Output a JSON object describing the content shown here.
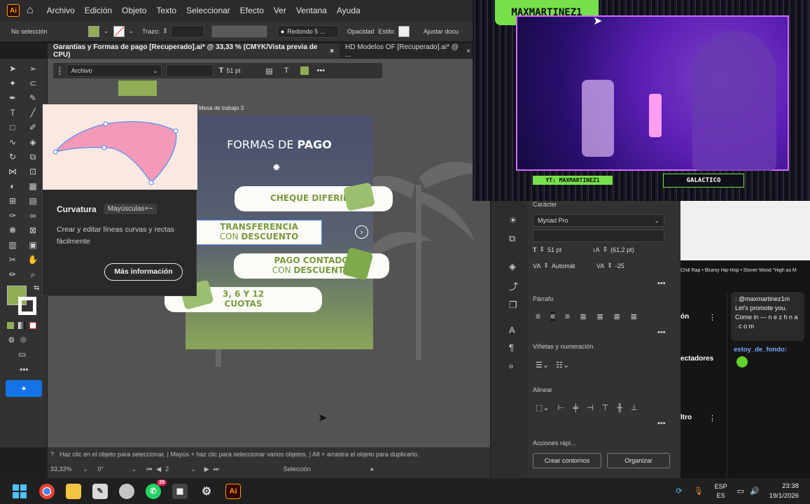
{
  "menu": [
    "Archivo",
    "Edición",
    "Objeto",
    "Texto",
    "Seleccionar",
    "Efecto",
    "Ver",
    "Ventana",
    "Ayuda"
  ],
  "app_logo": "Ai",
  "control": {
    "selection": "No selección",
    "stroke_label": "Trazo:",
    "brush": "Redondo 5 ...",
    "opacity": "Opacidad",
    "style": "Estilo:",
    "adjust": "Ajustar docu",
    "fill_color": "#8fae55"
  },
  "tabs": [
    "Garantías y Formas de pago [Recuperado].ai* @ 33,33 % (CMYK/Vista previa de CPU)",
    "HD Modelos OF [Recuperado].ai* @ ..."
  ],
  "context_bar": {
    "font": "Archivo",
    "size": "51 pt"
  },
  "artboard_label": "Mesa de trabajo 3",
  "tooltip": {
    "title": "Curvatura",
    "shortcut": "Mayúsculas+~",
    "desc": "Crear y editar líneas curvas y rectas fácilmente",
    "button": "Más información"
  },
  "artboard": {
    "title_a": "FORMAS DE ",
    "title_b": "PAGO",
    "items": [
      {
        "l1": "CHEQUE DIFERIDO",
        "l2": ""
      },
      {
        "l1": "TRANSFERENCIA",
        "l2a": "CON ",
        "l2b": "DESCUENTO"
      },
      {
        "l1": "PAGO CONTADO",
        "l2a": "CON ",
        "l2b": "DESCUENTO"
      },
      {
        "l1": "3, 6 Y 12",
        "l2": "CUOTAS"
      }
    ]
  },
  "status": {
    "hint": "Haz clic en el objeto para seleccionar. | Mayús + haz clic para seleccionar varios objetos. | Alt + arrastra el objeto para duplicarlo.",
    "zoom": "33,33%",
    "rotation": "0°",
    "page": "2",
    "mode": "Selección"
  },
  "panel": {
    "character": "Carácter",
    "font": "Myriad Pro",
    "size": "51 pt",
    "leading": "(61,2 pt)",
    "kerning": "Automát",
    "tracking": "-25",
    "paragraph": "Párrafo",
    "bullets": "Viñetas y numeración",
    "align": "Alinear",
    "quick": "Acciones rápi...",
    "btn_outline": "Crear contornos",
    "btn_arrange": "Organizar"
  },
  "stream": {
    "name": "MAXMARTINEZ1",
    "yt": "YT: MAXMARTINEZ1",
    "tag": "GALACTICO"
  },
  "chat": {
    "ticker": "Chill Rap • Bluesy Hip-Hop • Stoner Mood \"High as M",
    "label_on": "ón",
    "label_espectadores": "ectadores",
    "label_filtro": "ltro",
    "msg1": ": @maxmartinez1m Let's promote you. Come in — n e z h n a . c o m",
    "user2": "estoy_de_fondo",
    "badge": "29"
  },
  "taskbar": {
    "lang": "ESP",
    "region": "ES",
    "time": "23:38",
    "date": "19/1/2026"
  }
}
